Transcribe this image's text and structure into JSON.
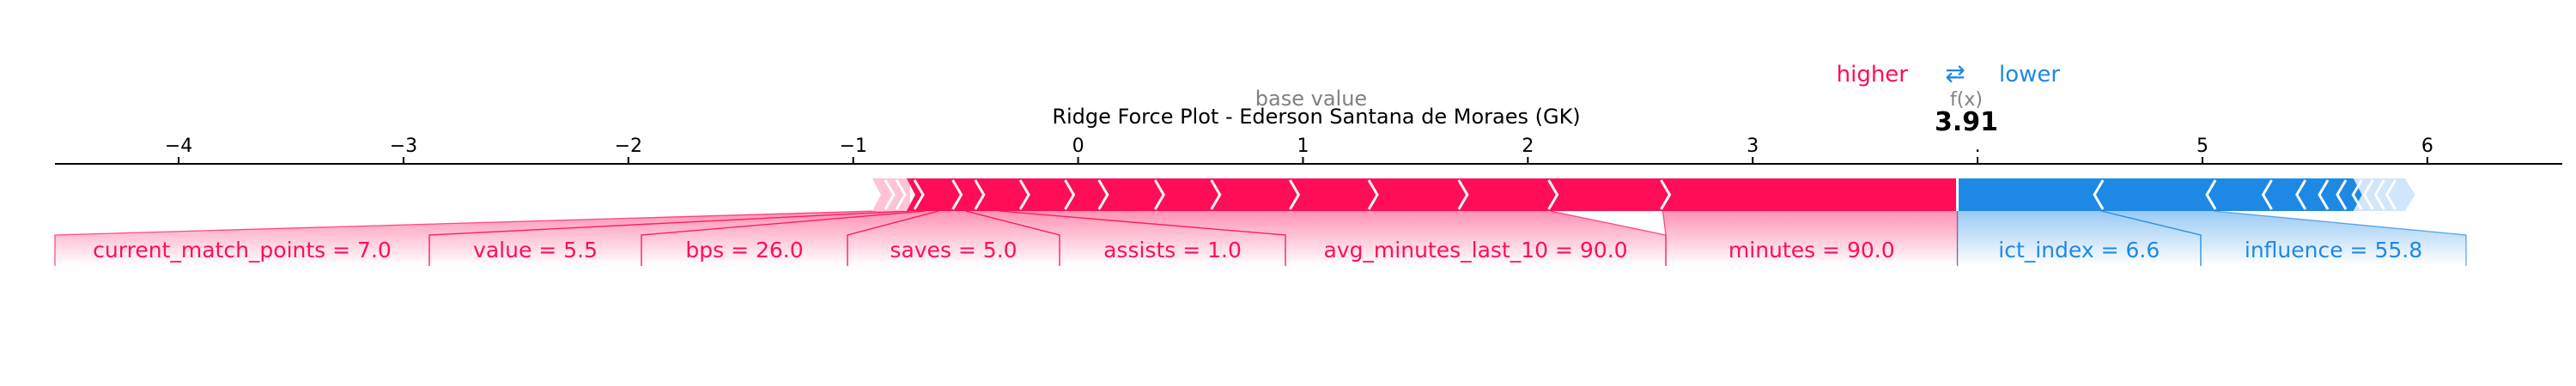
{
  "chart_data": {
    "type": "force",
    "title": "Ridge Force Plot - Ederson Santana de Moraes (GK)",
    "base_value_label": "base value",
    "fx_label": "f(x)",
    "fx_value_text": "3.91",
    "higher_label": "higher",
    "lower_label": "lower",
    "arrows_glyph": "⇄",
    "base_value": 1.0,
    "output_value": 3.91,
    "xlim": [
      -4.55,
      6.6
    ],
    "ticks": [
      -4,
      -3,
      -2,
      -1,
      0,
      1,
      2,
      3,
      4,
      5,
      6
    ],
    "tick_labels": [
      "−4",
      "−3",
      "−2",
      "−1",
      "0",
      "1",
      "2",
      "3",
      ".",
      "5",
      "6"
    ],
    "positive_features": [
      {
        "label": "current_match_points = 7.0",
        "start": -0.9,
        "end": -0.75
      },
      {
        "label": "value = 5.5",
        "start": -0.75,
        "end": -0.68
      },
      {
        "label": "bps = 26.0",
        "start": -0.68,
        "end": -0.62
      },
      {
        "label": "saves = 5.0",
        "start": -0.62,
        "end": -0.5
      },
      {
        "label": "assists = 1.0",
        "start": -0.5,
        "end": -0.35
      },
      {
        "label": "avg_minutes_last_10 = 90.0",
        "start": -0.35,
        "end": 2.1
      },
      {
        "label": "minutes = 90.0",
        "start": 2.6,
        "end": 3.91
      }
    ],
    "positive_unlabeled_boundaries": [
      -0.85,
      -0.8,
      -0.72,
      -0.55,
      -0.45,
      -0.25,
      -0.05,
      0.1,
      0.35,
      0.6,
      0.95,
      1.3,
      1.7,
      2.1
    ],
    "negative_features": [
      {
        "label": "ict_index = 6.6",
        "start": 3.91,
        "end": 4.55
      },
      {
        "label": "influence = 55.8",
        "start": 4.55,
        "end": 5.05
      }
    ],
    "negative_unlabeled_boundaries": [
      5.05,
      5.3,
      5.45,
      5.55,
      5.63,
      5.7,
      5.75,
      5.8,
      5.85
    ],
    "negative_end": 5.9,
    "colors": {
      "positive": "#ff0d57",
      "positive_light": "#ffc3d5",
      "negative": "#1e88e5",
      "negative_light": "#d1e6fa",
      "axis": "#000000",
      "grey_label": "#808080"
    }
  }
}
